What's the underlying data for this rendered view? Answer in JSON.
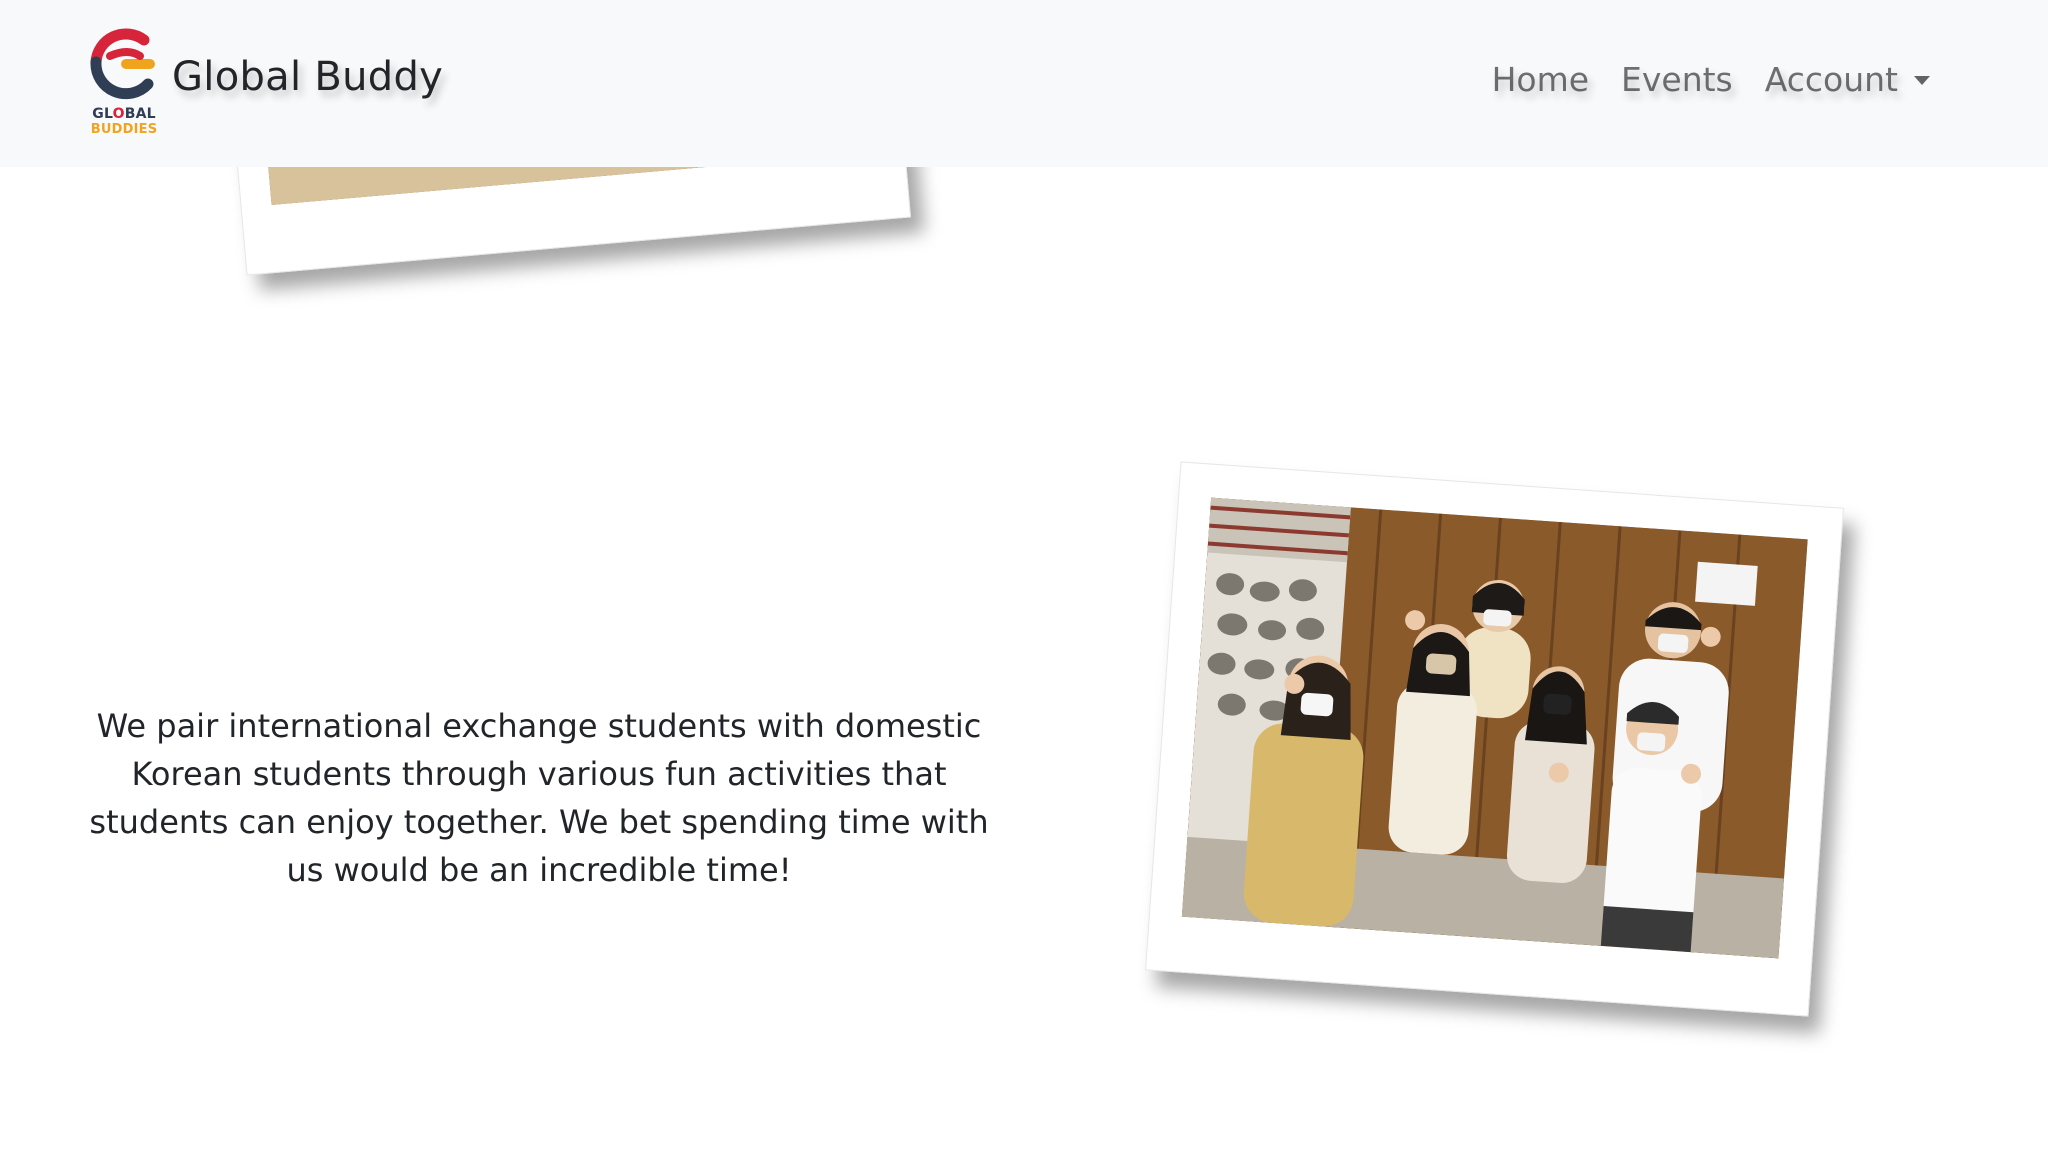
{
  "navbar": {
    "brand_name": "Global Buddy",
    "logo_text_line1_a": "GL",
    "logo_text_line1_dot": "O",
    "logo_text_line1_b": "BAL",
    "logo_text_line2": "BUDDIES",
    "links": {
      "home": "Home",
      "events": "Events",
      "account": "Account"
    }
  },
  "main": {
    "description": "We pair international exchange students with domestic Korean students through various fun activities that students can enjoy together. We bet spending time with us would be an incredible time!"
  },
  "colors": {
    "navbar_bg": "#f8f9fa",
    "brand_red": "#d6253a",
    "brand_navy": "#2f3d55",
    "brand_yellow": "#f0a41e",
    "nav_link": "#737373",
    "text": "#212529"
  }
}
